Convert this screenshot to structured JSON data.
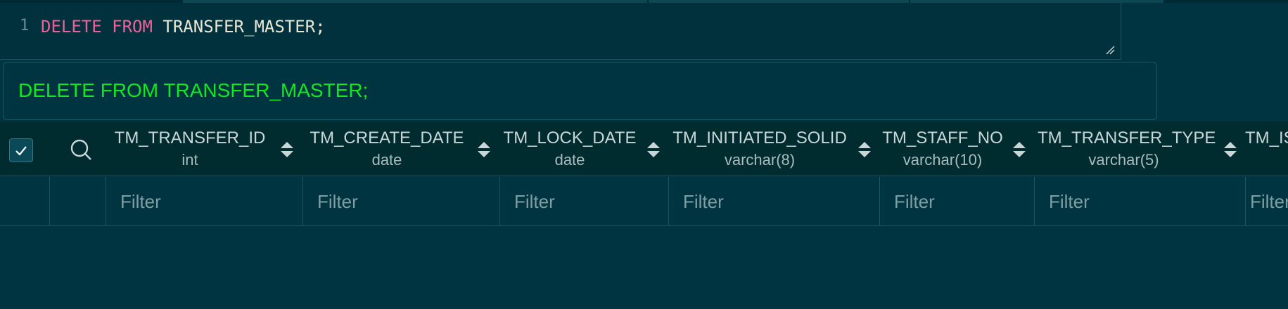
{
  "editor": {
    "line_number": "1",
    "keyword_delete": "DELETE",
    "keyword_from": "FROM",
    "table_name": "TRANSFER_MASTER;"
  },
  "query_display": {
    "text": "DELETE FROM TRANSFER_MASTER;",
    "color": "#10e820"
  },
  "grid": {
    "columns": [
      {
        "name": "TM_TRANSFER_ID",
        "type": "int"
      },
      {
        "name": "TM_CREATE_DATE",
        "type": "date"
      },
      {
        "name": "TM_LOCK_DATE",
        "type": "date"
      },
      {
        "name": "TM_INITIATED_SOLID",
        "type": "varchar(8)"
      },
      {
        "name": "TM_STAFF_NO",
        "type": "varchar(10)"
      },
      {
        "name": "TM_TRANSFER_TYPE",
        "type": "varchar(5)"
      },
      {
        "name": "TM_IS",
        "type": ""
      }
    ],
    "filter_placeholder": "Filter",
    "select_all_icon": "checkmark-icon",
    "search_icon": "search-icon",
    "sort_icon": "sort-updown-icon"
  },
  "colors": {
    "background": "#003440",
    "header_background": "#002c30",
    "keyword": "#f0609a"
  }
}
